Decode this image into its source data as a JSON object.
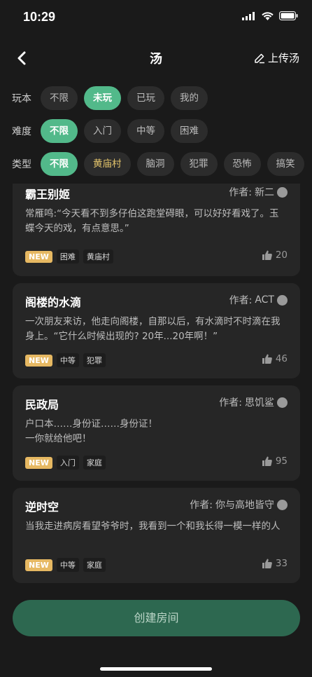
{
  "status": {
    "time": "10:29"
  },
  "nav": {
    "title": "汤",
    "upload_label": "上传汤"
  },
  "filters": {
    "play": {
      "label": "玩本",
      "options": [
        "不限",
        "未玩",
        "已玩",
        "我的"
      ],
      "selected": "未玩"
    },
    "difficulty": {
      "label": "难度",
      "options": [
        "不限",
        "入门",
        "中等",
        "困难"
      ],
      "selected": "不限"
    },
    "type": {
      "label": "类型",
      "options": [
        "不限",
        "黄庙村",
        "脑洞",
        "犯罪",
        "恐怖",
        "搞笑"
      ],
      "selected": "不限"
    }
  },
  "cards": [
    {
      "title": "霸王别姬",
      "author_label": "作者:",
      "author": "新二",
      "desc": "常雁鸣:“今天看不到多仔伯这跑堂碍眼，可以好好看戏了。玉蝶今天的戏，有点意思。”",
      "badge": "NEW",
      "tags": [
        "困难",
        "黄庙村"
      ],
      "likes": "20"
    },
    {
      "title": "阁楼的水滴",
      "author_label": "作者:",
      "author": "ACT",
      "desc": "一次朋友来访，他走向阁楼，自那以后，有水滴时不时滴在我身上。“它什么时候出现的? 20年...20年啊！”",
      "badge": "NEW",
      "tags": [
        "中等",
        "犯罪"
      ],
      "likes": "46"
    },
    {
      "title": "民政局",
      "author_label": "作者:",
      "author": "思饥鲨",
      "desc": "户口本……身份证……身份证！\n一你就给他吧！",
      "badge": "NEW",
      "tags": [
        "入门",
        "家庭"
      ],
      "likes": "95"
    },
    {
      "title": "逆时空",
      "author_label": "作者:",
      "author": "你与高地皆守",
      "desc": "当我走进病房看望爷爷时，我看到一个和我长得一模一样的人",
      "badge": "NEW",
      "tags": [
        "中等",
        "家庭"
      ],
      "likes": "33"
    }
  ],
  "create_button": "创建房间",
  "colors": {
    "accent": "#52b98a",
    "badge": "#e6b862",
    "button": "#2d6850"
  }
}
